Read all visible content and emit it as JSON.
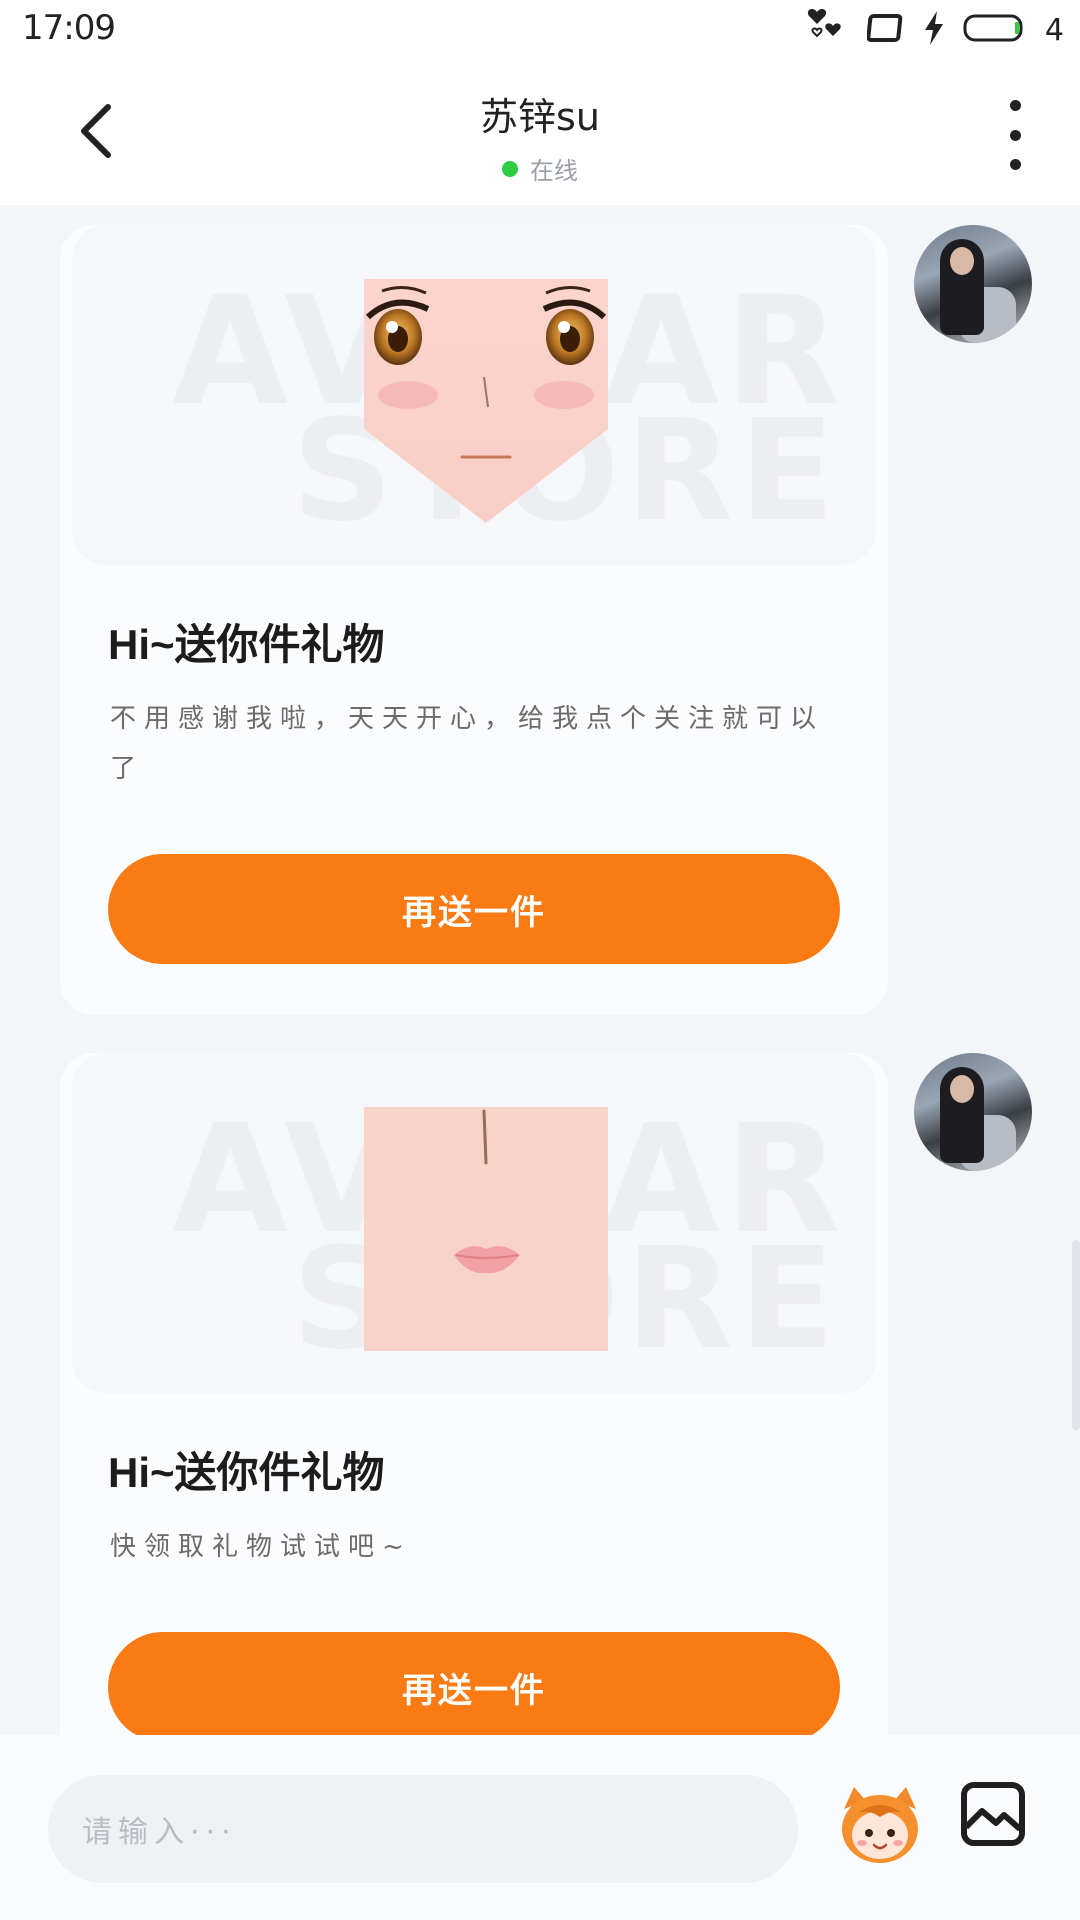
{
  "status_bar": {
    "time": "17:09",
    "battery_level": "4",
    "icons": [
      "notification-heart-icon",
      "screen-icon",
      "charging-icon",
      "battery-icon"
    ]
  },
  "header": {
    "contact_name": "苏锌su",
    "status_text": "在线",
    "status_color": "#2ecc40",
    "back_icon": "chevron-left-icon",
    "more_icon": "more-vertical-icon"
  },
  "messages": [
    {
      "type": "gift",
      "watermark_top": "AVATAR",
      "watermark_bottom": "STORE",
      "gift_image": "anime-face-gift",
      "title": "Hi~送你件礼物",
      "description": "不用感谢我啦，天天开心，给我点个关注就可以了",
      "button_label": "再送一件"
    },
    {
      "type": "gift",
      "watermark_top": "AVATAR",
      "watermark_bottom": "STORE",
      "gift_image": "lips-gift",
      "title": "Hi~送你件礼物",
      "description": "快领取礼物试试吧~",
      "button_label": "再送一件"
    }
  ],
  "input_bar": {
    "placeholder": "请输入···",
    "mascot_icon": "mascot-emoji-icon",
    "image_icon": "image-icon"
  },
  "colors": {
    "accent": "#fa7a14",
    "background": "#f3f5f9",
    "card": "#fbfcfe"
  }
}
